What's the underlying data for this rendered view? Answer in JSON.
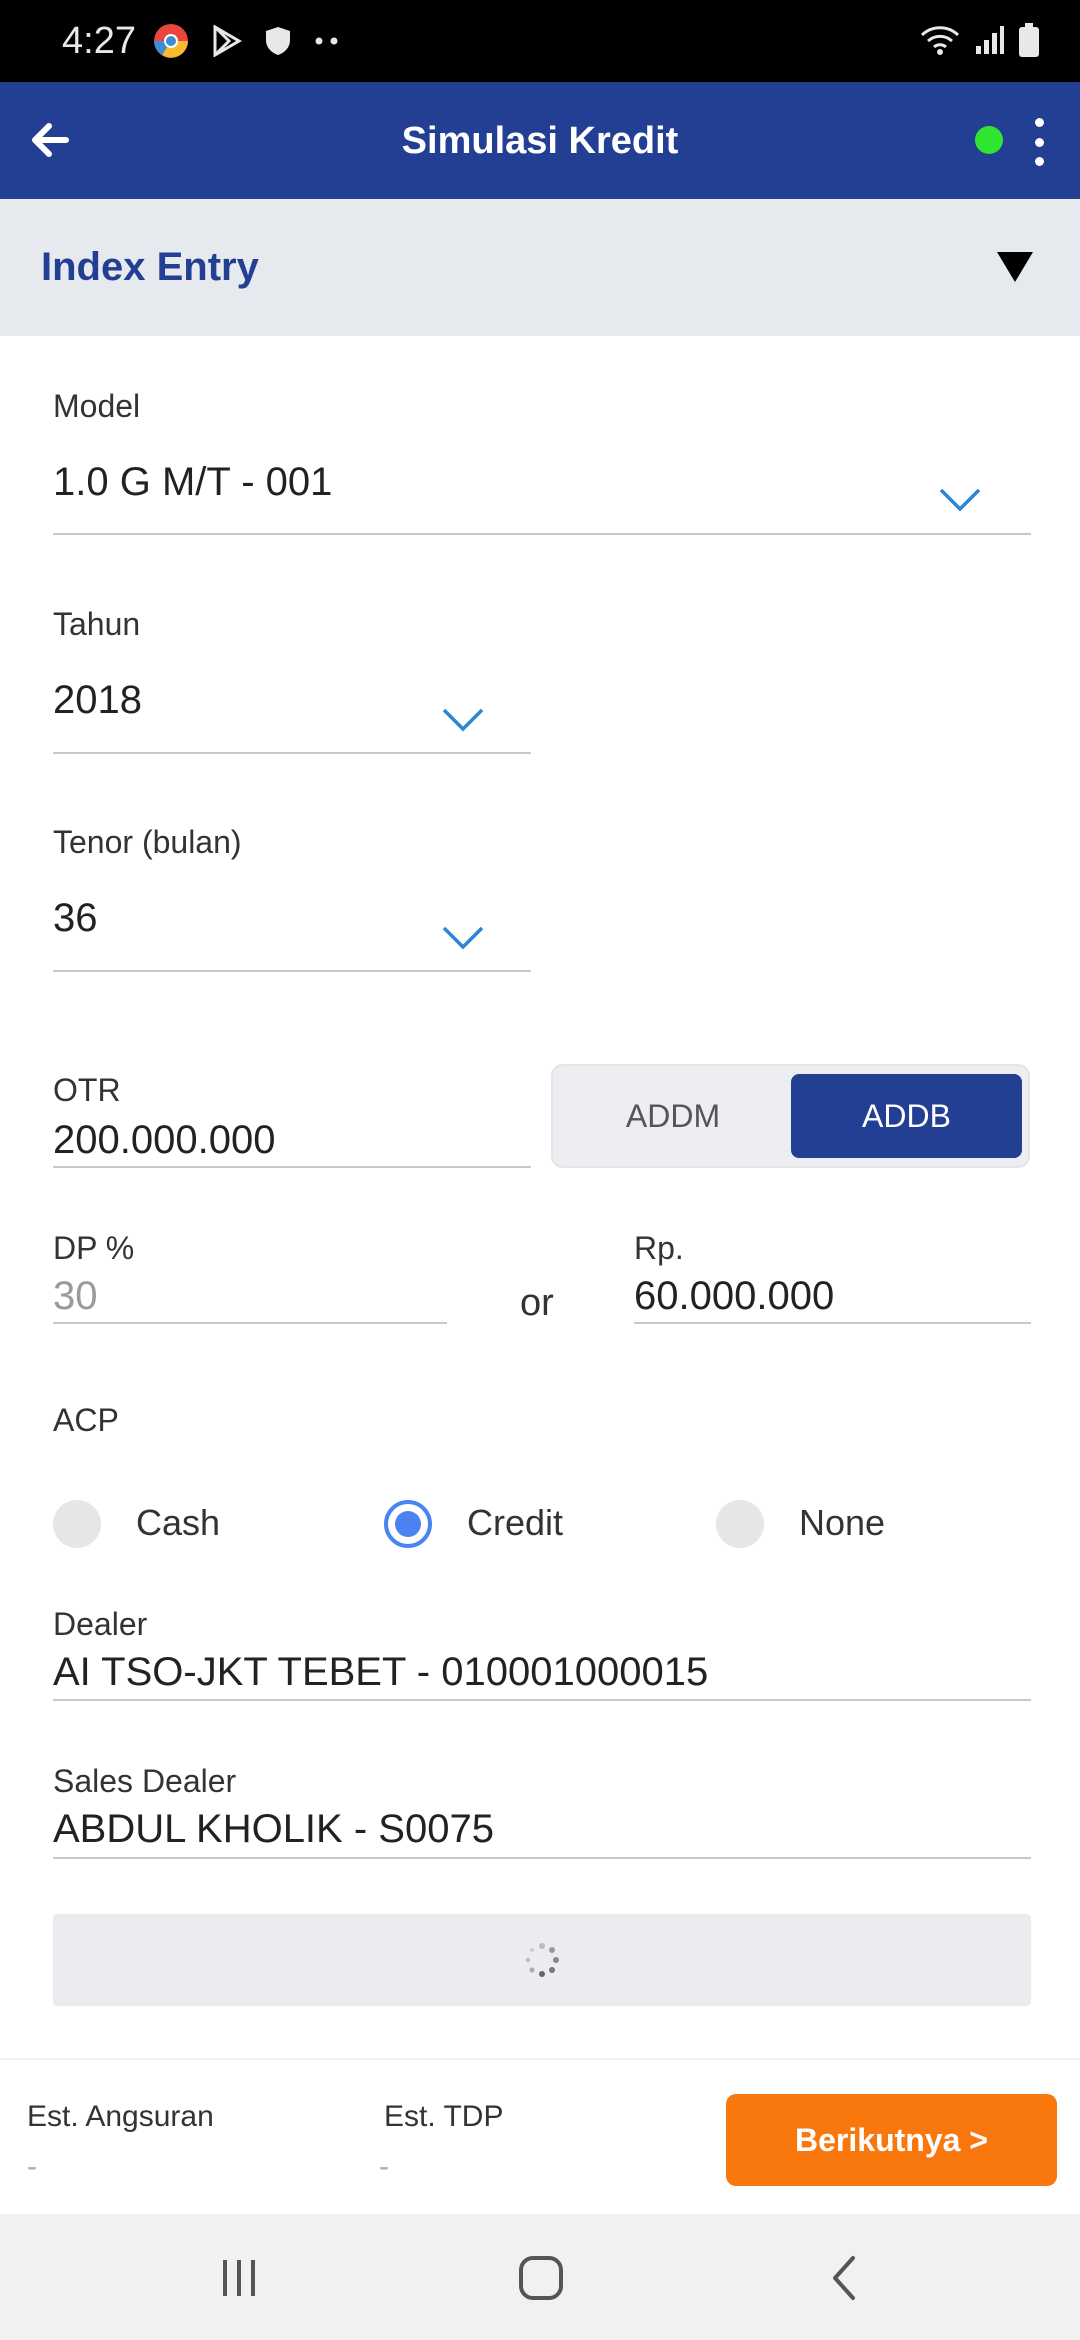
{
  "status_bar": {
    "time": "4:27"
  },
  "app_bar": {
    "title": "Simulasi Kredit",
    "online_color": "#2fe52f"
  },
  "section": {
    "title": "Index Entry"
  },
  "form": {
    "model": {
      "label": "Model",
      "value": "1.0 G M/T - 001"
    },
    "tahun": {
      "label": "Tahun",
      "value": "2018"
    },
    "tenor": {
      "label": "Tenor (bulan)",
      "value": "36"
    },
    "otr": {
      "label": "OTR",
      "value": "200.000.000"
    },
    "segment": {
      "options": [
        "ADDM",
        "ADDB"
      ],
      "selected": "ADDB"
    },
    "dp_percent": {
      "label": "DP %",
      "value": "30"
    },
    "or_text": "or",
    "dp_amount": {
      "label": "Rp.",
      "value": "60.000.000"
    },
    "acp": {
      "label": "ACP",
      "options": [
        "Cash",
        "Credit",
        "None"
      ],
      "selected": "Credit"
    },
    "dealer": {
      "label": "Dealer",
      "value": "AI TSO-JKT TEBET - 010001000015"
    },
    "sales_dealer": {
      "label": "Sales Dealer",
      "value": "ABDUL KHOLIK - S0075"
    }
  },
  "summary": {
    "angsuran": {
      "label": "Est. Angsuran",
      "value": "-"
    },
    "tdp": {
      "label": "Est. TDP",
      "value": "-"
    },
    "next_button": "Berikutnya >"
  },
  "colors": {
    "primary": "#233f93",
    "accent": "#f9780e",
    "radio": "#4b84f0"
  },
  "icons": [
    "back-arrow-icon",
    "more-vert-icon",
    "triangle-down-icon",
    "chevron-down-icon",
    "spinner-icon",
    "recent-apps-icon",
    "home-icon",
    "nav-back-icon"
  ]
}
